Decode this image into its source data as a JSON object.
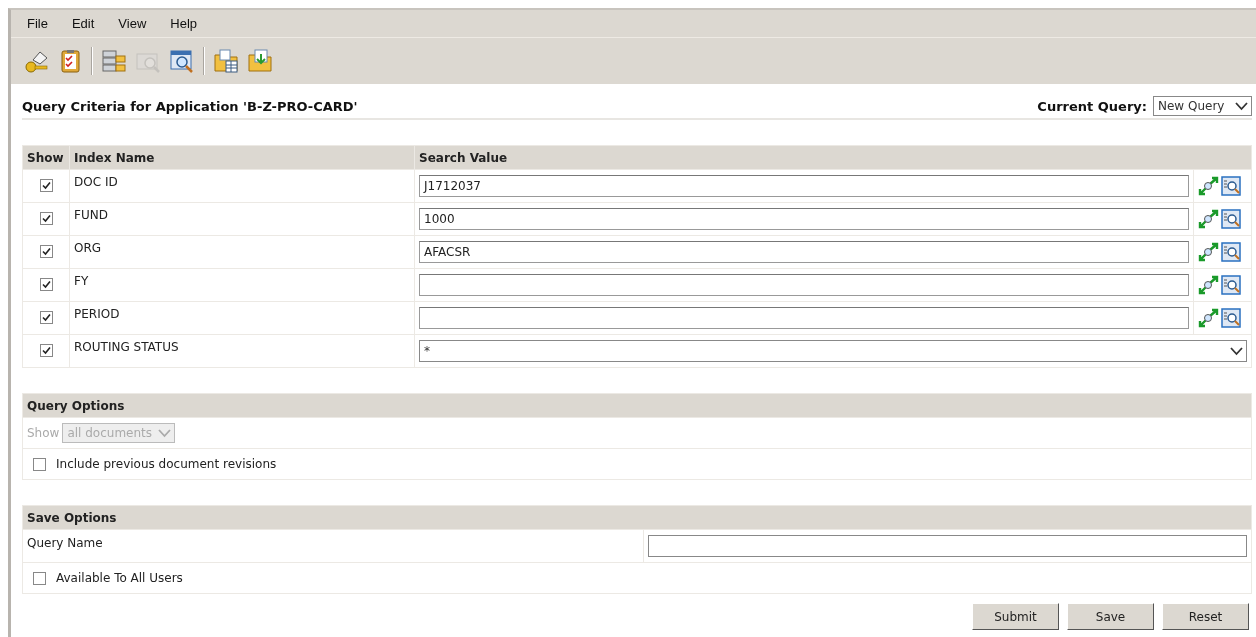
{
  "menu": [
    "File",
    "Edit",
    "View",
    "Help"
  ],
  "toolbar": [
    {
      "kind": "key",
      "disabled": false
    },
    {
      "kind": "clipboard",
      "disabled": false
    },
    {
      "kind": "separator"
    },
    {
      "kind": "database",
      "disabled": false
    },
    {
      "kind": "search",
      "disabled": true
    },
    {
      "kind": "search-window",
      "disabled": false
    },
    {
      "kind": "separator"
    },
    {
      "kind": "folder-table",
      "disabled": false
    },
    {
      "kind": "folder-arrow",
      "disabled": false
    }
  ],
  "title": "Query Criteria for Application 'B-Z-PRO-CARD'",
  "current_query": {
    "label": "Current Query:",
    "value": "New Query"
  },
  "criteria": {
    "columns": [
      "Show",
      "Index Name",
      "Search Value"
    ],
    "rows": [
      {
        "name": "DOC ID",
        "checked": true,
        "kind": "text",
        "value": "J1712037"
      },
      {
        "name": "FUND",
        "checked": true,
        "kind": "text",
        "value": "1000"
      },
      {
        "name": "ORG",
        "checked": true,
        "kind": "text",
        "value": "AFACSR"
      },
      {
        "name": "FY",
        "checked": true,
        "kind": "text"
      },
      {
        "name": "PERIOD",
        "checked": true,
        "kind": "text"
      },
      {
        "name": "ROUTING STATUS",
        "checked": true,
        "kind": "select",
        "value": "*"
      }
    ]
  },
  "query_options": {
    "title": "Query Options",
    "show_label": "Show",
    "show_value": "all documents",
    "show_disabled": true,
    "include_revisions": {
      "label": "Include previous document revisions",
      "checked": false
    }
  },
  "save_options": {
    "title": "Save Options",
    "query_name_label": "Query Name",
    "all_users": {
      "label": "Available To All Users",
      "checked": false
    }
  },
  "buttons": [
    "Submit",
    "Save",
    "Reset"
  ]
}
